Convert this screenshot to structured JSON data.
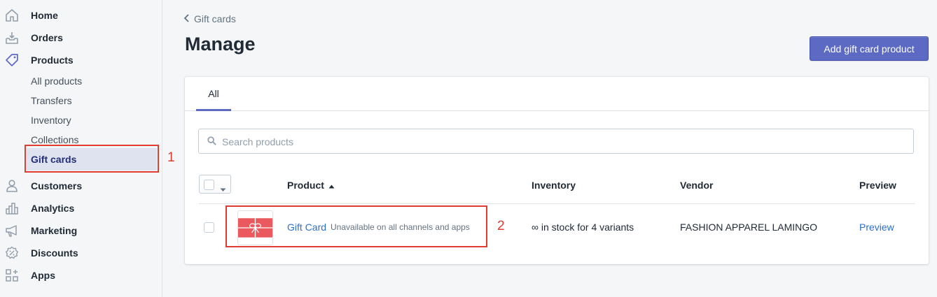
{
  "sidebar": {
    "items": [
      {
        "label": "Home",
        "icon": "home-icon"
      },
      {
        "label": "Orders",
        "icon": "orders-icon"
      },
      {
        "label": "Products",
        "icon": "tag-icon"
      },
      {
        "label": "Customers",
        "icon": "person-icon"
      },
      {
        "label": "Analytics",
        "icon": "bar-chart-icon"
      },
      {
        "label": "Marketing",
        "icon": "megaphone-icon"
      },
      {
        "label": "Discounts",
        "icon": "discount-icon"
      },
      {
        "label": "Apps",
        "icon": "apps-grid-icon"
      }
    ],
    "products_subitems": [
      "All products",
      "Transfers",
      "Inventory",
      "Collections",
      "Gift cards"
    ],
    "active_subitem": "Gift cards"
  },
  "annotations": {
    "first": "1",
    "second": "2",
    "color": "#e03c31"
  },
  "header": {
    "breadcrumb": "Gift cards",
    "title": "Manage",
    "primary_button": "Add gift card product"
  },
  "tabs": [
    {
      "label": "All",
      "selected": true
    }
  ],
  "search": {
    "placeholder": "Search products",
    "value": ""
  },
  "table": {
    "columns": [
      "Product",
      "Inventory",
      "Vendor",
      "Preview"
    ],
    "sort_column": "Product",
    "sort_direction": "ascending",
    "rows": [
      {
        "product": "Gift Card",
        "note": "Unavailable on all channels and apps",
        "inventory": "∞ in stock for 4 variants",
        "vendor": "FASHION APPAREL LAMINGO",
        "preview": "Preview"
      }
    ]
  },
  "colors": {
    "accent": "#5c6ac4",
    "link": "#2c6ecb",
    "thumbnail": "#e9595e"
  }
}
